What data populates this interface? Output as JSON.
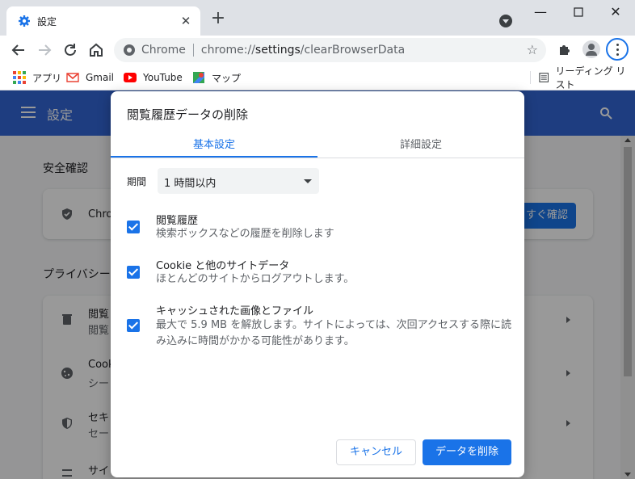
{
  "browser": {
    "tab_title": "設定",
    "omnibox_scheme": "Chrome",
    "omnibox_url_host": "chrome://",
    "omnibox_url_main": "settings",
    "omnibox_url_path": "/clearBrowserData",
    "bookmarks": [
      "アプリ",
      "Gmail",
      "YouTube",
      "マップ"
    ],
    "reading_list": "リーディング リスト",
    "accent": "#1a73e8"
  },
  "settings_page": {
    "title": "設定",
    "safety_heading": "安全確認",
    "safety_row_label": "Chro",
    "safety_button": "すぐ確認",
    "privacy_heading": "プライバシー",
    "rows": [
      {
        "label": "閲覧",
        "sub": "閲覧"
      },
      {
        "label": "Cook",
        "sub": "シー"
      },
      {
        "label": "セキ",
        "sub": "セー"
      },
      {
        "label": "サイ",
        "sub": ""
      }
    ],
    "header_color": "#3367d6"
  },
  "dialog": {
    "title": "閲覧履歴データの削除",
    "tabs": [
      {
        "label": "基本設定",
        "selected": true
      },
      {
        "label": "詳細設定",
        "selected": false
      }
    ],
    "time_range_label": "期間",
    "time_range_value": "1 時間以内",
    "options": [
      {
        "title": "閲覧履歴",
        "desc": "検索ボックスなどの履歴を削除します",
        "checked": true
      },
      {
        "title": "Cookie と他のサイトデータ",
        "desc": "ほとんどのサイトからログアウトします。",
        "checked": true
      },
      {
        "title": "キャッシュされた画像とファイル",
        "desc": "最大で 5.9 MB を解放します。サイトによっては、次回アクセスする際に読み込みに時間がかかる可能性があります。",
        "checked": true
      }
    ],
    "cancel_label": "キャンセル",
    "delete_label": "データを削除"
  }
}
